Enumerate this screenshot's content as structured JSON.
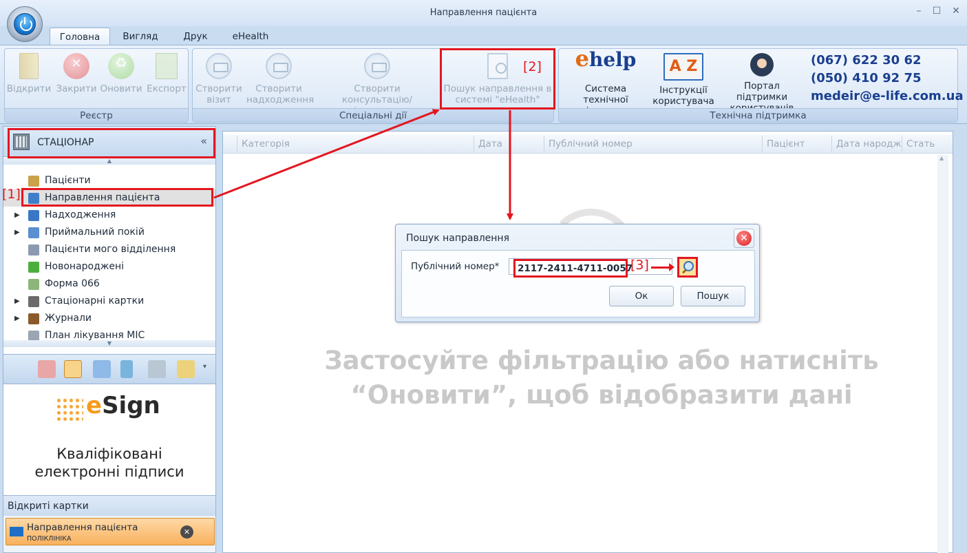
{
  "window": {
    "title": "Направлення пацієнта",
    "controls": [
      "–",
      "☐",
      "✕"
    ]
  },
  "tabs": [
    "Головна",
    "Вигляд",
    "Друк",
    "eHealth"
  ],
  "ribbon": {
    "registry": {
      "label": "Реєстр",
      "buttons": [
        "Відкрити",
        "Закрити",
        "Оновити",
        "Експорт"
      ]
    },
    "special": {
      "label": "Спеціальні дії",
      "buttons": [
        {
          "line1": "Створити",
          "line2": "візит"
        },
        {
          "line1": "Створити",
          "line2": "надходження"
        },
        {
          "line1": "Створити",
          "line2": "консультацію/діагностику"
        },
        {
          "line1": "Пошук направлення в",
          "line2": "системі \"eHealth\""
        }
      ]
    },
    "support": {
      "label": "Технічна підтримка",
      "ehelp_logo": {
        "e": "e",
        "rest": "help"
      },
      "az_logo": "A Z",
      "buttons": [
        {
          "line1": "Система технічної",
          "line2": "підтримки"
        },
        {
          "line1": "Інструкції",
          "line2": "користувача"
        },
        {
          "line1": "Портал підтримки",
          "line2": "користувачів"
        }
      ],
      "phone1": "(067) 622 30 62",
      "phone2": "(050) 410 92 75",
      "email": "medeir@e-life.com.ua"
    }
  },
  "sidebar": {
    "header": "СТАЦІОНАР",
    "collapse": "«",
    "items": [
      {
        "label": "Пацієнти",
        "expandable": false,
        "color": "#c9a24a"
      },
      {
        "label": "Направлення пацієнта",
        "expandable": false,
        "color": "#3f7fc9"
      },
      {
        "label": "Надходження",
        "expandable": true,
        "color": "#3a78c7"
      },
      {
        "label": "Приймальний покій",
        "expandable": true,
        "color": "#5a8fd1"
      },
      {
        "label": "Пацієнти мого відділення",
        "expandable": false,
        "color": "#8a9bb0"
      },
      {
        "label": "Новонароджені",
        "expandable": false,
        "color": "#4caf3d"
      },
      {
        "label": "Форма 066",
        "expandable": false,
        "color": "#8db67a"
      },
      {
        "label": "Стаціонарні картки",
        "expandable": true,
        "color": "#6b6b6b"
      },
      {
        "label": "Журнали",
        "expandable": true,
        "color": "#8b5a2b"
      },
      {
        "label": "План лікування МІС",
        "expandable": false,
        "color": "#9aa6b2"
      }
    ],
    "scroll_up": "▲",
    "scroll_down": "▼",
    "esign": {
      "brand_e": "e",
      "brand_rest": "Sign",
      "line1": "Кваліфіковані",
      "line2": "електронні підписи"
    },
    "opened_cards": {
      "title": "Відкриті картки",
      "card_title": "Направлення пацієнта",
      "card_subtitle": "ПОЛІКЛІНІКА",
      "close": "✕"
    }
  },
  "grid": {
    "columns": [
      "Категорія",
      "Дата",
      "Публічний номер",
      "Пацієнт",
      "Дата народж",
      "Стать"
    ],
    "empty_line1": "Застосуйте фільтрацію або натисніть",
    "empty_line2": "“Оновити”, щоб відобразити дані"
  },
  "dialog": {
    "title": "Пошук направлення",
    "field_label": "Публічний номер*",
    "field_value": "2117-2411-4711-0057",
    "ok": "Ок",
    "search": "Пошук",
    "close": "✕"
  },
  "annotations": {
    "m1": "[1]",
    "m2": "[2]",
    "m3": "[3]",
    "color": "#e3161f"
  }
}
